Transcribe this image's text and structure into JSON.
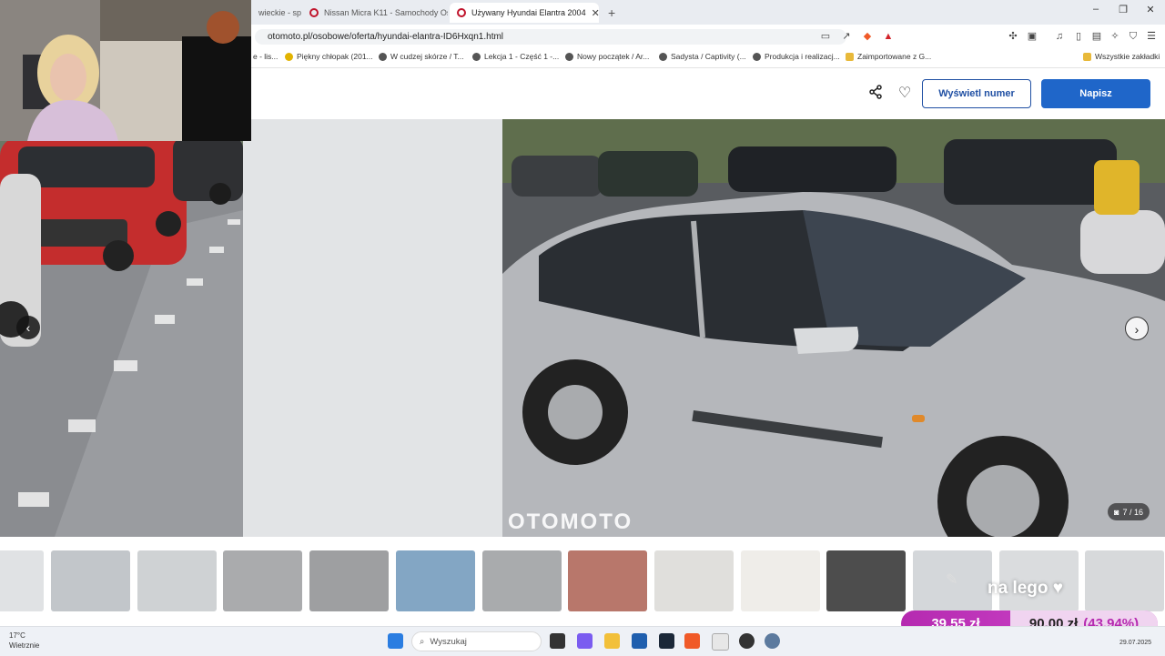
{
  "browser": {
    "tabs": [
      {
        "label": "wieckie - sp",
        "active": false
      },
      {
        "label": "Nissan Micra K11 - Samochody Osob",
        "active": false
      },
      {
        "label": "Używany Hyundai Elantra 2004",
        "active": true
      }
    ],
    "new_tab": "+",
    "url": "otomoto.pl/osobowe/oferta/hyundai-elantra-ID6Hxqn1.html",
    "bookmarks": [
      {
        "label": "e - lis..."
      },
      {
        "label": "Piękny chłopak (201..."
      },
      {
        "label": "W cudzej skórze / T..."
      },
      {
        "label": "Lekcja 1 - Część 1 -..."
      },
      {
        "label": "Nowy początek / Ar..."
      },
      {
        "label": "Sadysta / Captivity (..."
      },
      {
        "label": "Produkcja i realizacj..."
      },
      {
        "label": "Zaimportowane z G..."
      },
      {
        "label": "Wszystkie zakładki"
      }
    ]
  },
  "header": {
    "show_number_label": "Wyświetl numer",
    "write_label": "Napisz"
  },
  "gallery": {
    "watermark": "OTOMOTO",
    "counter": "7 / 16",
    "thumbnail_count": 14,
    "selected_thumbnail": 11
  },
  "stream_overlay": {
    "text": "na lego ♥",
    "current": "39,55 zł",
    "goal": "90,00 zł",
    "percent": "(43.94%)",
    "progress": 0.4394
  },
  "taskbar": {
    "temperature": "17°C",
    "weather": "Wietrznie",
    "search_placeholder": "Wyszukaj",
    "date": "29.07.2025"
  },
  "colors": {
    "brand_blue": "#1f66c9",
    "outline_blue": "#1f4fa3",
    "donation_magenta": "#b52ab0"
  }
}
